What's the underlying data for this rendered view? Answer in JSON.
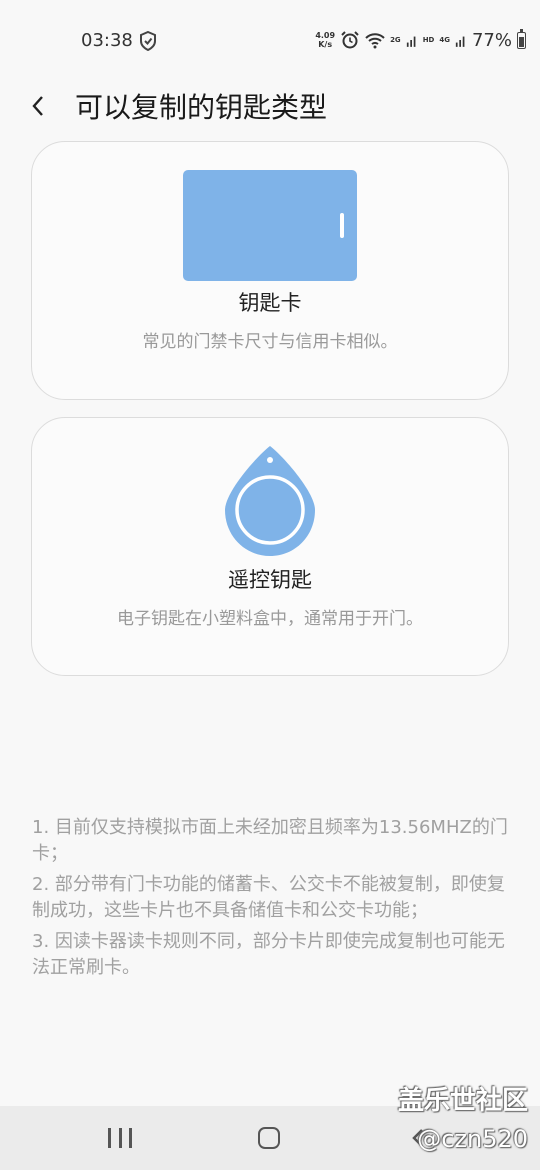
{
  "status_bar": {
    "time": "03:38",
    "speed_value": "4.09",
    "speed_unit": "K/s",
    "net1": "2G",
    "net2": "HD",
    "net3": "4G",
    "battery": "77%"
  },
  "header": {
    "title": "可以复制的钥匙类型"
  },
  "cards": [
    {
      "title": "钥匙卡",
      "description": "常见的门禁卡尺寸与信用卡相似。",
      "icon": "key-card-icon",
      "color": "#7fb3e8"
    },
    {
      "title": "遥控钥匙",
      "description": "电子钥匙在小塑料盒中，通常用于开门。",
      "icon": "key-fob-icon",
      "color": "#7fb3e8"
    }
  ],
  "notes": [
    "1. 目前仅支持模拟市面上未经加密且频率为13.56MHZ的门卡；",
    "2. 部分带有门卡功能的储蓄卡、公交卡不能被复制，即使复制成功，这些卡片也不具备储值卡和公交卡功能；",
    "3. 因读卡器读卡规则不同，部分卡片即使完成复制也可能无法正常刷卡。"
  ],
  "watermark": {
    "site": "盖乐世社区",
    "user": "@czn520"
  }
}
